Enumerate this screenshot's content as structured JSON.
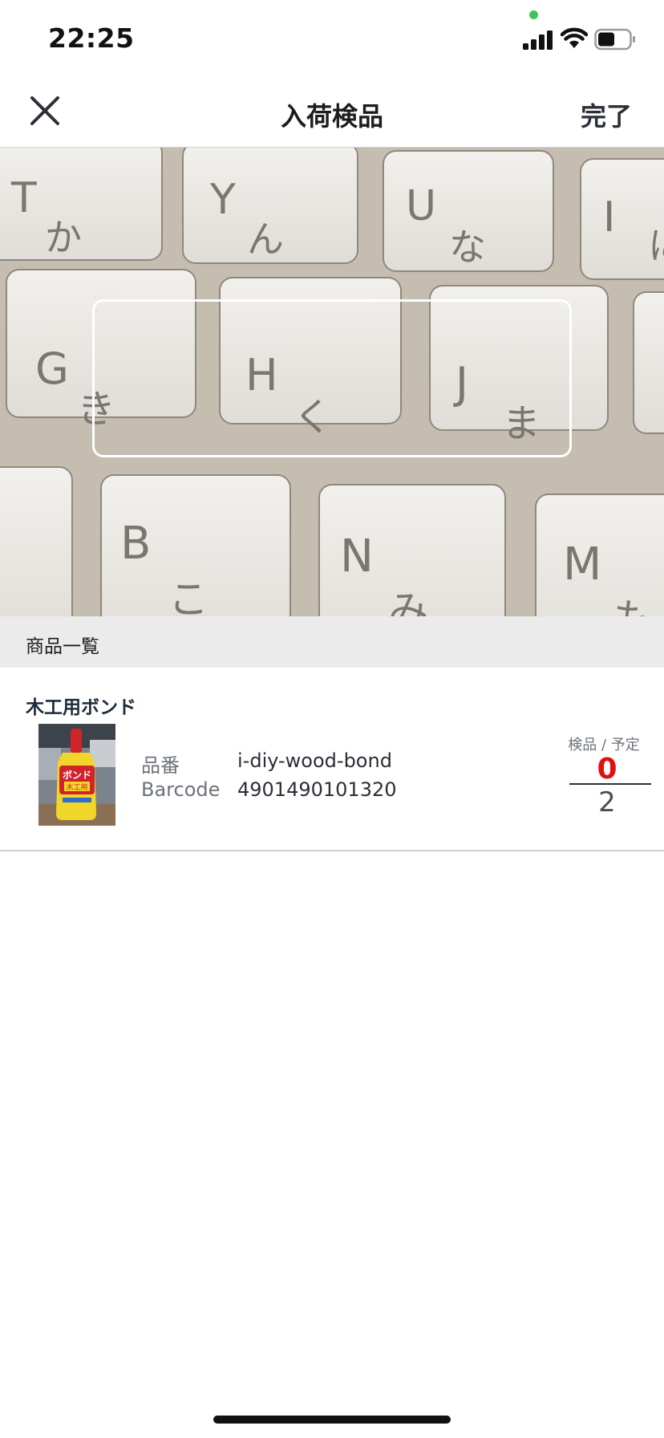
{
  "status_bar": {
    "time": "22:25",
    "icons": [
      "signal-icon",
      "wifi-icon",
      "battery-icon"
    ],
    "privacy_dot_color": "#3ec45a"
  },
  "nav": {
    "close_icon": "close-icon",
    "title": "入荷検品",
    "done_label": "完了"
  },
  "camera": {
    "keycaps": [
      {
        "letter": "T",
        "kana": "か"
      },
      {
        "letter": "Y",
        "kana": "ん"
      },
      {
        "letter": "U",
        "kana": "な"
      },
      {
        "letter": "I",
        "kana": "に"
      },
      {
        "letter": "G",
        "kana": "き"
      },
      {
        "letter": "H",
        "kana": "く"
      },
      {
        "letter": "J",
        "kana": "ま"
      },
      {
        "letter": "B",
        "kana": "こ"
      },
      {
        "letter": "N",
        "kana": "み"
      },
      {
        "letter": "M",
        "kana": "も"
      }
    ]
  },
  "section": {
    "title": "商品一覧"
  },
  "products": [
    {
      "name": "木工用ボンド",
      "image_label": "ボンド",
      "image_sublabel": "木工用",
      "part_number_label": "品番",
      "part_number": "i-diy-wood-bond",
      "barcode_label": "Barcode",
      "barcode": "4901490101320",
      "count_header": "検品 / 予定",
      "inspected": "0",
      "planned": "2"
    }
  ],
  "colors": {
    "inspected_count": "#e01010",
    "section_bg": "#ebebeb"
  }
}
